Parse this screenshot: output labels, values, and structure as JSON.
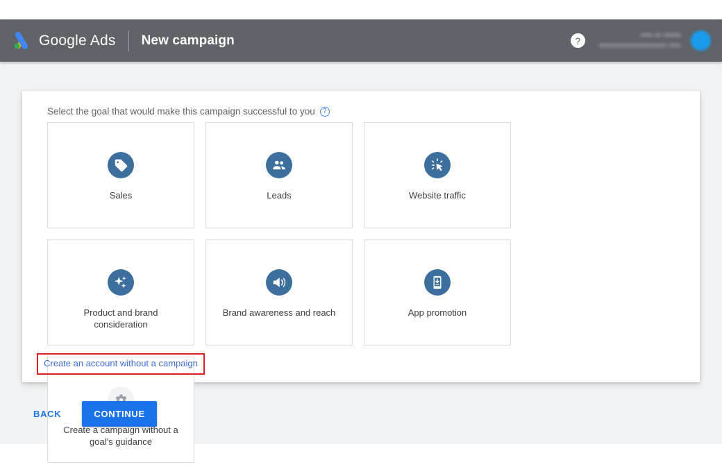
{
  "header": {
    "brand_name": "Google Ads",
    "page_title": "New campaign",
    "logo_icon": "google-ads-logo",
    "help_icon": "help-question-icon",
    "help_glyph": "?",
    "account_line1": "•••• •• ••••••",
    "account_line2": "••••••••••••••••••••••• ••••",
    "avatar_icon": "user-avatar",
    "bar_color": "#5f6368"
  },
  "main": {
    "prompt": "Select the goal that would make this campaign successful to you",
    "prompt_help_icon": "help-question-icon",
    "prompt_help_glyph": "?",
    "goals": [
      {
        "label": "Sales",
        "icon": "tag-icon",
        "icon_color": "#3c6f9e",
        "style": "blue"
      },
      {
        "label": "Leads",
        "icon": "people-icon",
        "icon_color": "#3c6f9e",
        "style": "blue"
      },
      {
        "label": "Website traffic",
        "icon": "cursor-click-icon",
        "icon_color": "#3c6f9e",
        "style": "blue"
      },
      {
        "label": "Product and brand consideration",
        "icon": "sparkles-icon",
        "icon_color": "#3c6f9e",
        "style": "blue"
      },
      {
        "label": "Brand awareness and reach",
        "icon": "megaphone-speaker-icon",
        "icon_color": "#3c6f9e",
        "style": "blue"
      },
      {
        "label": "App promotion",
        "icon": "mobile-download-icon",
        "icon_color": "#3c6f9e",
        "style": "blue"
      },
      {
        "label": "Create a campaign without a goal's guidance",
        "icon": "gear-icon",
        "icon_color": "#9aa0a6",
        "style": "grey"
      }
    ],
    "account_link": "Create an account without a campaign",
    "account_link_color": "#3f6ad8",
    "highlight_color": "#e02020"
  },
  "footer": {
    "back_label": "BACK",
    "continue_label": "CONTINUE",
    "continue_color": "#1a73e8"
  }
}
